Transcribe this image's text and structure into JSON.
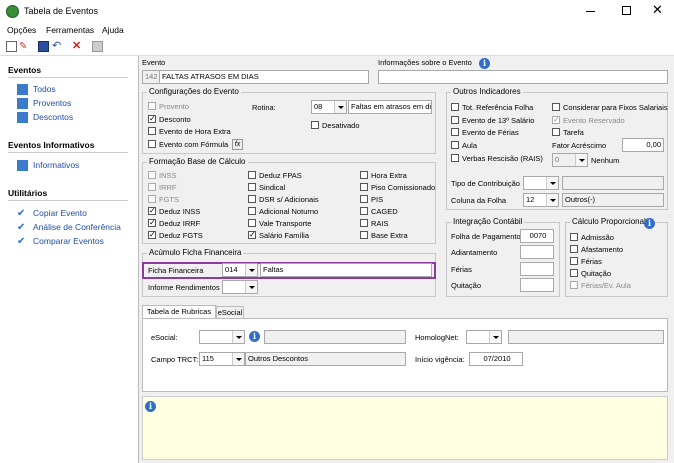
{
  "window": {
    "title": "Tabela de Eventos"
  },
  "menu": [
    "Opções",
    "Ferramentas",
    "Ajuda"
  ],
  "sidebar": {
    "sections": [
      {
        "title": "Eventos",
        "items": [
          "Todos",
          "Proventos",
          "Descontos"
        ]
      },
      {
        "title": "Eventos Informativos",
        "items": [
          "Informativos"
        ]
      },
      {
        "title": "Utilitários",
        "items": [
          "Copiar Evento",
          "Análise de Conferência",
          "Comparar Eventos"
        ]
      }
    ]
  },
  "evento": {
    "label": "Evento",
    "code": "142",
    "name": "FALTAS ATRASOS EM DIAS",
    "info_label": "Informações sobre o Evento"
  },
  "config": {
    "title": "Configurações do Evento",
    "proventos": "Provento",
    "desconto": "Desconto",
    "hora_extra": "Evento de Hora Extra",
    "formula": "Evento com Fórmula",
    "formula_icon": "fx",
    "rotina_label": "Rotina:",
    "rotina_code": "08",
    "rotina_text": "Faltas em atrasos em dia",
    "desativado": "Desativado"
  },
  "outros": {
    "title": "Outros Indicadores",
    "items": [
      "Tot. Referência Folha",
      "Evento de 13º Salário",
      "Evento de Férias",
      "Aula",
      "Verbas Rescisão (RAIS)",
      "Considerar para Fixos Salariais",
      "Evento Reservado",
      "Tarefa"
    ],
    "fator_label": "Fator Acréscimo",
    "fator_value": "0,00",
    "nenhum_code": "0",
    "nenhum_text": "Nenhum",
    "tipo_label": "Tipo de Contribuição",
    "coluna_label": "Coluna da Folha",
    "coluna_value": "12",
    "coluna_text": "Outros(-)"
  },
  "formacao": {
    "title": "Formação Base de Cálculo",
    "col1": [
      "INSS",
      "IRRF",
      "FGTS",
      "Deduz INSS",
      "Deduz IRRF",
      "Deduz FGTS"
    ],
    "col2": [
      "Deduz FPAS",
      "Sindical",
      "DSR s/ Adicionais",
      "Adicional Noturno",
      "Vale Transporte",
      "Salário Família"
    ],
    "col3": [
      "Hora Extra",
      "Piso Comissionado",
      "PIS",
      "CAGED",
      "RAIS",
      "Base Extra"
    ]
  },
  "acumulo": {
    "title": "Acúmulo Ficha Financeira",
    "ficha_label": "Ficha Financeira",
    "ficha_code": "014",
    "ficha_text": "Faltas",
    "informe_label": "Informe Rendimentos"
  },
  "integracao": {
    "title": "Integração Contábil",
    "rows": [
      "Folha de Pagamento",
      "Adiantamento",
      "Férias",
      "Quitação"
    ],
    "folha_value": "0070"
  },
  "calculo": {
    "title": "Cálculo Proporcional",
    "items": [
      "Admissão",
      "Afastamento",
      "Férias",
      "Quitação",
      "Férias/Ev. Aula"
    ]
  },
  "tabs": [
    "Tabela de Rubricas",
    "eSocial"
  ],
  "rubricas": {
    "esocial_label": "eSocial:",
    "homolog_label": "HomologNet:",
    "trct_label": "Campo TRCT:",
    "trct_code": "115",
    "trct_text": "Outros Descontos",
    "vigencia_label": "Início vigência:",
    "vigencia_value": "07/2010"
  },
  "colors": {
    "highlight": "#8e3a9e",
    "link": "#1f4fa0",
    "info_panel": "#ffffe1"
  }
}
